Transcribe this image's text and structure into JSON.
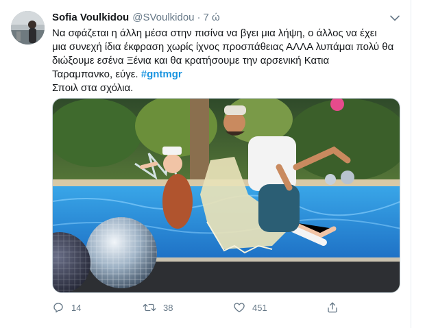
{
  "tweet": {
    "author": {
      "display_name": "Sofia Voulkidou",
      "handle": "@SVoulkidou",
      "separator": "·",
      "time": "7 ώ"
    },
    "text_lines": [
      "Να σφάζεται η άλλη μέσα στην πισίνα να βγει μια λήψη, ο άλλος να έχει",
      "μια συνεχή ίδια έκφραση χωρίς ίχνος προσπάθειας ΑΛΛΑ λυπάμαι πολύ θα",
      "διώξουμε εσένα Ξένια και θα κρατήσουμε την αρσενική Κατια",
      "Ταραμπανκο, εύγε."
    ],
    "hashtag": "#gntmgr",
    "text_last_line": "Σποιλ στα σχόλια.",
    "media": {
      "alt": "photo"
    },
    "actions": {
      "reply_count": "14",
      "retweet_count": "38",
      "like_count": "451"
    },
    "icons": {
      "caret": "chevron-down-icon",
      "reply": "reply-icon",
      "retweet": "retweet-icon",
      "like": "heart-icon",
      "share": "share-icon"
    },
    "colors": {
      "text": "#14171a",
      "secondary": "#657786",
      "link": "#1b95e0",
      "border": "#e6ecf0"
    }
  }
}
